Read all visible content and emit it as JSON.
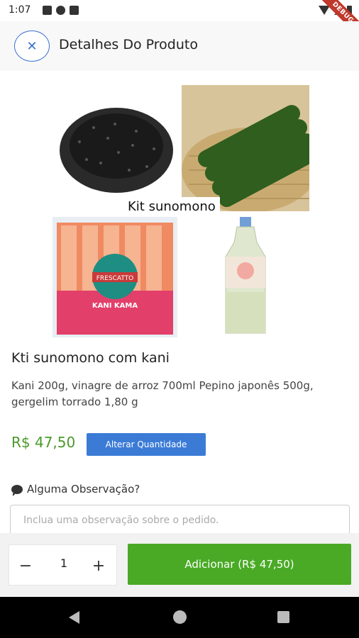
{
  "status_bar": {
    "time": "1:07",
    "debug_banner": "DEBUG"
  },
  "header": {
    "close_icon": "close-icon",
    "title": "Detalhes Do Produto"
  },
  "product": {
    "image_label": "Kit sunomono",
    "images": [
      "sesame-seeds",
      "cucumbers",
      "kani-kama-package",
      "rice-vinegar-bottle"
    ],
    "kani_package_brand": "FRESCATTO",
    "kani_package_label": "KANI KAMA",
    "name": "Kti sunomono com kani",
    "description": "Kani 200g, vinagre de arroz 700ml Pepino japonês 500g, gergelim torrado 1,80 g",
    "price": "R$ 47,50",
    "change_quantity_label": "Alterar Quantidade"
  },
  "observation": {
    "label": "Alguma Observação?",
    "icon": "chat-icon",
    "placeholder": "Inclua uma observação sobre o pedido."
  },
  "cart": {
    "minus": "−",
    "quantity": "1",
    "plus": "+",
    "add_label": "Adicionar (R$ 47,50)"
  },
  "colors": {
    "accent_blue": "#3b7bd6",
    "price_green": "#4a9a2a",
    "add_button_green": "#4aaa26"
  }
}
